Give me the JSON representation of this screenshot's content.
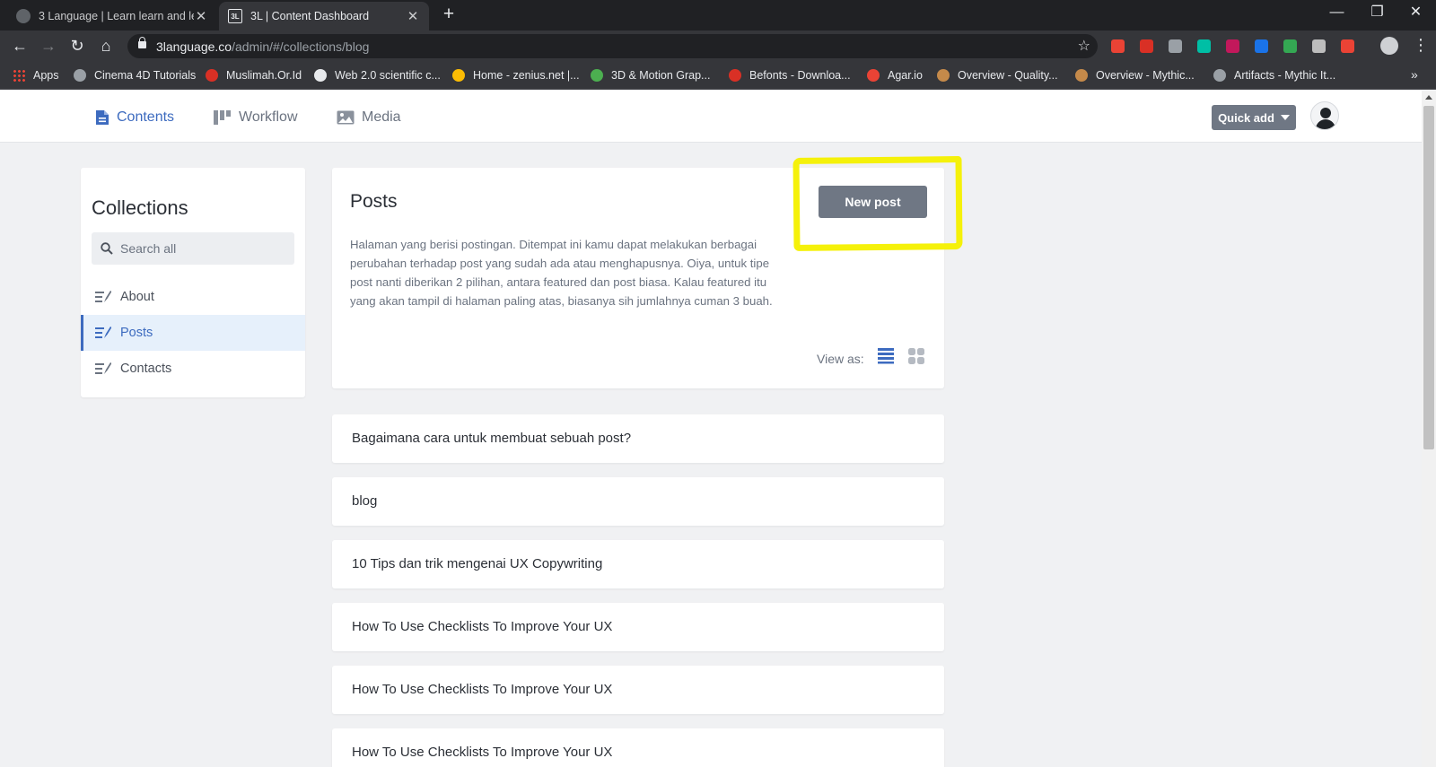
{
  "browser": {
    "tabs": [
      {
        "title": "3 Language | Learn learn and lear",
        "active": false,
        "favicon": "globe-icon"
      },
      {
        "title": "3L | Content Dashboard",
        "active": true,
        "favicon_text": "3L"
      }
    ],
    "new_tab_label": "+",
    "url_host": "3language.co",
    "url_path": "/admin/#/collections/blog",
    "bookmarks": [
      {
        "label": "Apps",
        "color": "#ea4335"
      },
      {
        "label": "Cinema 4D Tutorials",
        "color": "#9aa0a6"
      },
      {
        "label": "Muslimah.Or.Id",
        "color": "#d93025"
      },
      {
        "label": "Web 2.0 scientific c...",
        "color": "#e8eaed"
      },
      {
        "label": "Home - zenius.net |...",
        "color": "#fbbc04"
      },
      {
        "label": "3D & Motion Grap...",
        "color": "#4caf50"
      },
      {
        "label": "Befonts - Downloa...",
        "color": "#d93025"
      },
      {
        "label": "Agar.io",
        "color": "#ea4335"
      },
      {
        "label": "Overview - Quality...",
        "color": "#c58a4a"
      },
      {
        "label": "Overview - Mythic...",
        "color": "#c58a4a"
      },
      {
        "label": "Artifacts - Mythic It...",
        "color": "#9aa0a6"
      }
    ],
    "bookmarks_more": "»",
    "extension_colors": [
      "#ea4335",
      "#d93025",
      "#9aa0a6",
      "#00bfa5",
      "#c2185b",
      "#1a73e8",
      "#34a853",
      "#bdbdbd",
      "#ea4335"
    ]
  },
  "app": {
    "nav": {
      "contents": "Contents",
      "workflow": "Workflow",
      "media": "Media"
    },
    "quick_add": "Quick add",
    "colors": {
      "accent": "#3d6bbf",
      "button": "#6f7784",
      "highlight": "#f5f10a"
    }
  },
  "sidebar": {
    "title": "Collections",
    "search_placeholder": "Search all",
    "items": [
      {
        "label": "About",
        "active": false
      },
      {
        "label": "Posts",
        "active": true
      },
      {
        "label": "Contacts",
        "active": false
      }
    ]
  },
  "posts": {
    "title": "Posts",
    "new_post": "New post",
    "description": "Halaman yang berisi postingan. Ditempat ini kamu dapat melakukan berbagai perubahan terhadap post yang sudah ada atau menghapusnya. Oiya, untuk tipe post nanti diberikan 2 pilihan, antara featured dan post biasa. Kalau featured itu yang akan tampil di halaman paling atas, biasanya sih jumlahnya cuman 3 buah.",
    "view_as": "View as:",
    "entries": [
      "Bagaimana cara untuk membuat sebuah post?",
      "blog",
      "10 Tips dan trik mengenai UX Copywriting",
      "How To Use Checklists To Improve Your UX",
      "How To Use Checklists To Improve Your UX",
      "How To Use Checklists To Improve Your UX"
    ]
  }
}
